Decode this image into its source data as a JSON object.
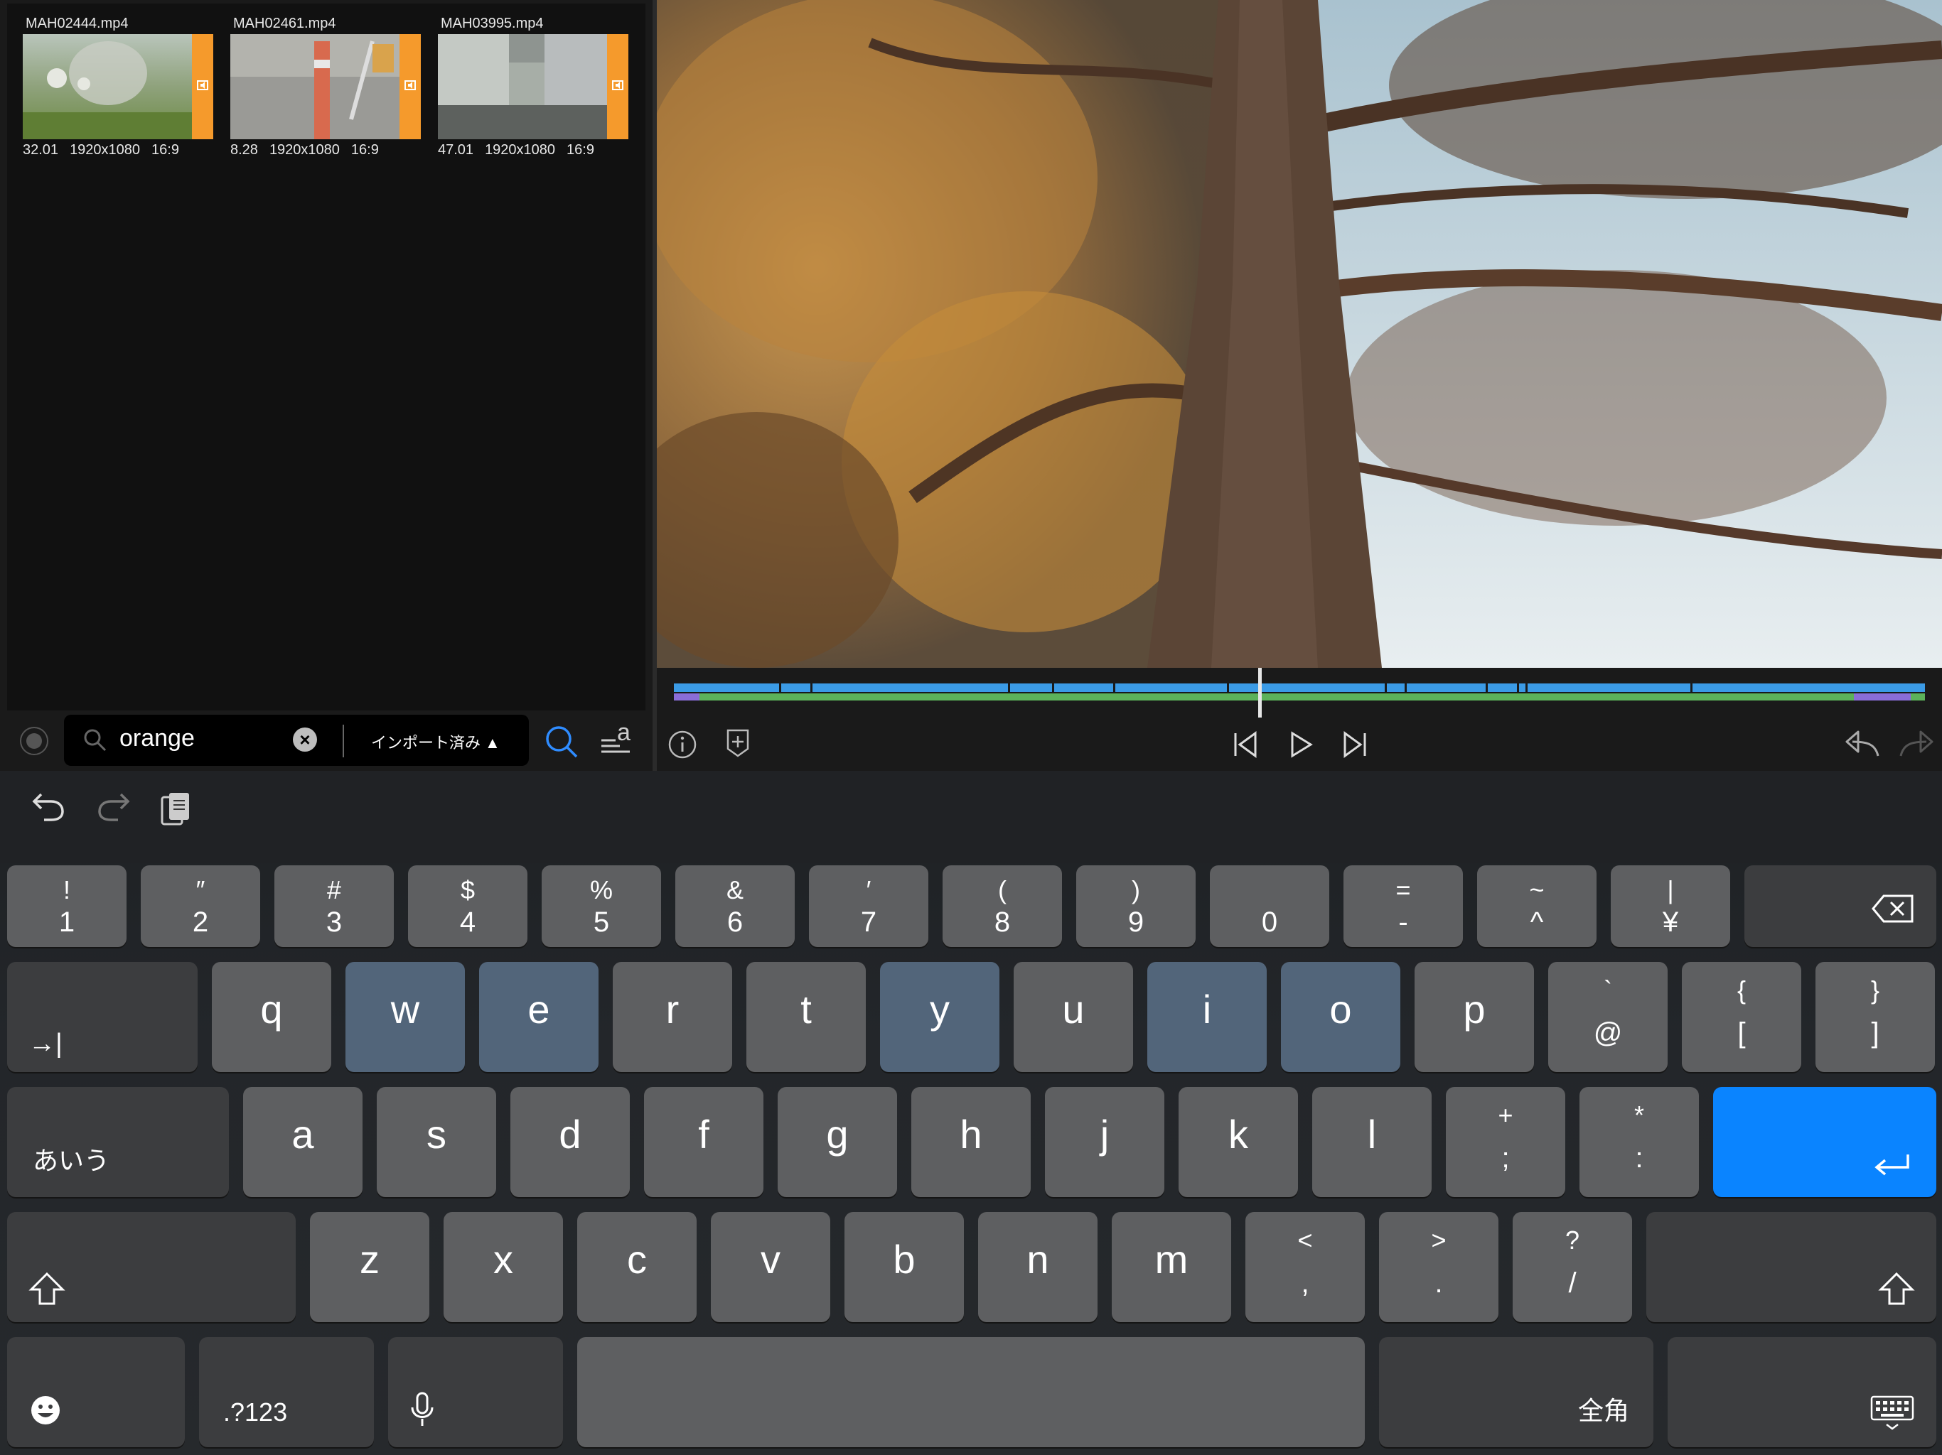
{
  "browser": {
    "clips": [
      {
        "name": "MAH02444.mp4",
        "duration": "32.01",
        "resolution": "1920x1080",
        "aspect": "16:9"
      },
      {
        "name": "MAH02461.mp4",
        "duration": "8.28",
        "resolution": "1920x1080",
        "aspect": "16:9"
      },
      {
        "name": "MAH03995.mp4",
        "duration": "47.01",
        "resolution": "1920x1080",
        "aspect": "16:9"
      }
    ],
    "search": {
      "value": "orange",
      "clear_label": "×",
      "filter_label": "インポート済み",
      "filter_caret": "▲"
    },
    "sort_glyph": "a"
  },
  "keyboard": {
    "number_row": [
      {
        "top": "!",
        "bot": "1"
      },
      {
        "top": "″",
        "bot": "2"
      },
      {
        "top": "#",
        "bot": "3"
      },
      {
        "top": "$",
        "bot": "4"
      },
      {
        "top": "%",
        "bot": "5"
      },
      {
        "top": "&",
        "bot": "6"
      },
      {
        "top": "′",
        "bot": "7"
      },
      {
        "top": "(",
        "bot": "8"
      },
      {
        "top": ")",
        "bot": "9"
      },
      {
        "top": "",
        "bot": "0"
      },
      {
        "top": "=",
        "bot": "-"
      },
      {
        "top": "~",
        "bot": "^"
      },
      {
        "top": "|",
        "bot": "¥"
      }
    ],
    "qwerty_row": [
      "q",
      "w",
      "e",
      "r",
      "t",
      "y",
      "u",
      "i",
      "o",
      "p"
    ],
    "qwerty_extra": [
      {
        "top": "`",
        "bot": "@"
      },
      {
        "top": "{",
        "bot": "["
      },
      {
        "top": "}",
        "bot": "]"
      }
    ],
    "home_row": [
      "a",
      "s",
      "d",
      "f",
      "g",
      "h",
      "j",
      "k",
      "l"
    ],
    "home_extra": [
      {
        "top": "+",
        "bot": ";"
      },
      {
        "top": "*",
        "bot": ":"
      }
    ],
    "bottom_row": [
      "z",
      "x",
      "c",
      "v",
      "b",
      "n",
      "m"
    ],
    "bottom_extra": [
      {
        "top": "<",
        "bot": ","
      },
      {
        "top": ">",
        "bot": "."
      },
      {
        "top": "?",
        "bot": "/"
      }
    ],
    "tab_glyph": "→|",
    "kana_label": "あいう",
    "numbers_label": ".?123",
    "zenkaku_label": "全角"
  },
  "colors": {
    "accent_orange": "#f59a2c",
    "timeline_blue": "#3b9be6",
    "timeline_green": "#5cb25a",
    "timeline_purple": "#8a6dd8",
    "return_key_blue": "#0a84ff",
    "search_active": "#2f8cff"
  }
}
